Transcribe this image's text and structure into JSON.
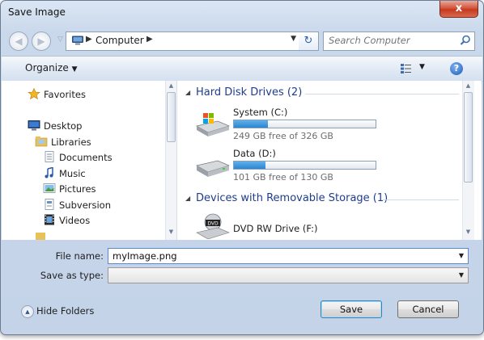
{
  "window": {
    "title": "Save Image",
    "close_glyph": "x"
  },
  "nav": {
    "back_icon": "back-arrow-icon",
    "forward_icon": "forward-arrow-icon",
    "address": {
      "location_icon": "computer-icon",
      "path_label": "Computer"
    },
    "refresh_icon": "refresh-icon",
    "search": {
      "placeholder": "Search Computer",
      "icon": "magnifier-icon"
    }
  },
  "toolbar": {
    "organize_label": "Organize",
    "help_label": "?"
  },
  "sidebar": {
    "items": [
      {
        "label": "Favorites",
        "icon": "star-icon"
      },
      {
        "label": "Desktop",
        "icon": "desktop-icon"
      },
      {
        "label": "Libraries",
        "icon": "libraries-icon"
      },
      {
        "label": "Documents",
        "icon": "documents-icon"
      },
      {
        "label": "Music",
        "icon": "music-icon"
      },
      {
        "label": "Pictures",
        "icon": "pictures-icon"
      },
      {
        "label": "Subversion",
        "icon": "subversion-icon"
      },
      {
        "label": "Videos",
        "icon": "videos-icon"
      }
    ]
  },
  "main": {
    "groups": [
      {
        "title": "Hard Disk Drives (2)",
        "drives": [
          {
            "name": "System (C:)",
            "free_text": "249 GB free of 326 GB",
            "used_fraction": 0.24,
            "icon": "windows-drive-icon"
          },
          {
            "name": "Data (D:)",
            "free_text": "101 GB free of 130 GB",
            "used_fraction": 0.22,
            "icon": "hard-drive-icon"
          }
        ]
      },
      {
        "title": "Devices with Removable Storage (1)",
        "drives": [
          {
            "name": "DVD RW Drive (F:)",
            "icon": "dvd-drive-icon"
          }
        ]
      }
    ]
  },
  "form": {
    "file_name_label": "File name:",
    "file_name_value": "myImage.png",
    "save_type_label": "Save as type:",
    "save_type_value": ""
  },
  "footer": {
    "hide_folders_label": "Hide Folders",
    "save_label": "Save",
    "cancel_label": "Cancel"
  },
  "colors": {
    "accent": "#1e3d8f",
    "drive_bar": "#2a86d0",
    "window_bg": "#c9d8eb"
  }
}
